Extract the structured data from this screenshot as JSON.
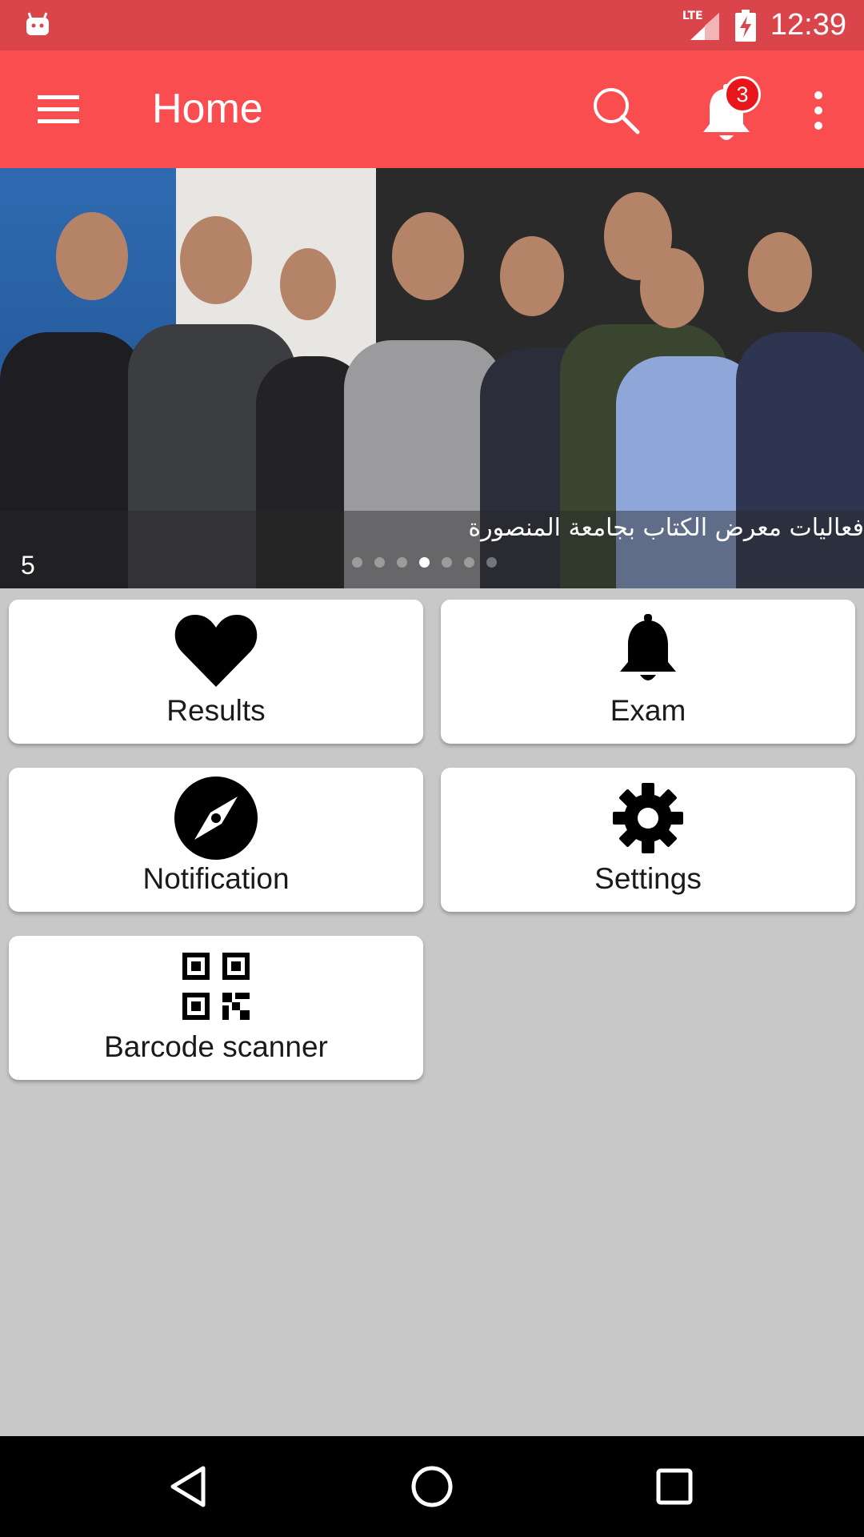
{
  "status_bar": {
    "time": "12:39",
    "network": "LTE",
    "icons": [
      "android-icon",
      "lte-signal-icon",
      "battery-charging-icon"
    ]
  },
  "app_bar": {
    "title": "Home",
    "notification_count": "3",
    "icons": [
      "menu-icon",
      "search-icon",
      "bell-icon",
      "overflow-icon"
    ]
  },
  "slider": {
    "caption": "فعاليات معرض الكتاب بجامعة المنصورة",
    "count": "5",
    "indicator_total": 7,
    "indicator_active": 4
  },
  "menu": {
    "results": {
      "label": "Results",
      "icon": "heart-icon"
    },
    "exam": {
      "label": "Exam",
      "icon": "bell-icon"
    },
    "notification": {
      "label": "Notification",
      "icon": "compass-icon"
    },
    "settings": {
      "label": "Settings",
      "icon": "gear-icon"
    },
    "barcode": {
      "label": "Barcode scanner",
      "icon": "qr-code-icon"
    }
  },
  "colors": {
    "status_bar": "#d9454a",
    "app_bar": "#f94d50",
    "badge": "#e8151a",
    "background": "#c8c8c8"
  }
}
